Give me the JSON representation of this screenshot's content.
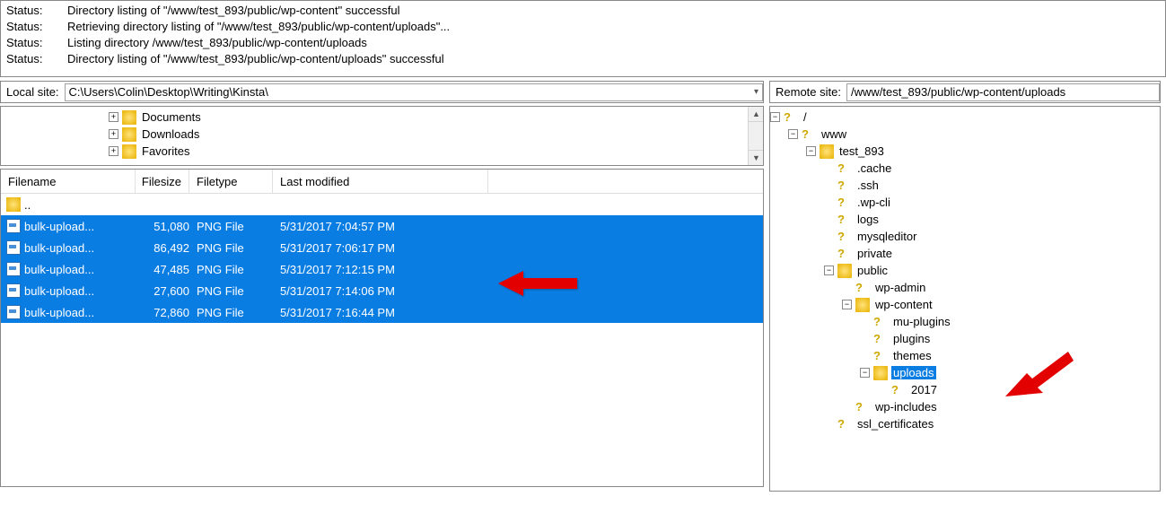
{
  "status": {
    "label": "Status:",
    "lines": [
      "Directory listing of \"/www/test_893/public/wp-content\" successful",
      "Retrieving directory listing of \"/www/test_893/public/wp-content/uploads\"...",
      "Listing directory /www/test_893/public/wp-content/uploads",
      "Directory listing of \"/www/test_893/public/wp-content/uploads\" successful"
    ]
  },
  "local": {
    "label": "Local site:",
    "path": "C:\\Users\\Colin\\Desktop\\Writing\\Kinsta\\",
    "tree": [
      {
        "name": "Documents",
        "expander": "+"
      },
      {
        "name": "Downloads",
        "expander": "+"
      },
      {
        "name": "Favorites",
        "expander": "+"
      }
    ],
    "columns": {
      "filename": "Filename",
      "filesize": "Filesize",
      "filetype": "Filetype",
      "modified": "Last modified"
    },
    "parent_row": "..",
    "files": [
      {
        "name": "bulk-upload...",
        "size": "51,080",
        "type": "PNG File",
        "modified": "5/31/2017 7:04:57 PM"
      },
      {
        "name": "bulk-upload...",
        "size": "86,492",
        "type": "PNG File",
        "modified": "5/31/2017 7:06:17 PM"
      },
      {
        "name": "bulk-upload...",
        "size": "47,485",
        "type": "PNG File",
        "modified": "5/31/2017 7:12:15 PM"
      },
      {
        "name": "bulk-upload...",
        "size": "27,600",
        "type": "PNG File",
        "modified": "5/31/2017 7:14:06 PM"
      },
      {
        "name": "bulk-upload...",
        "size": "72,860",
        "type": "PNG File",
        "modified": "5/31/2017 7:16:44 PM"
      }
    ]
  },
  "remote": {
    "label": "Remote site:",
    "path": "/www/test_893/public/wp-content/uploads",
    "tree": [
      {
        "depth": 0,
        "exp": "-",
        "icon": "q",
        "name": "/",
        "sel": false
      },
      {
        "depth": 1,
        "exp": "-",
        "icon": "q",
        "name": "www",
        "sel": false
      },
      {
        "depth": 2,
        "exp": "-",
        "icon": "f",
        "name": "test_893",
        "sel": false
      },
      {
        "depth": 3,
        "exp": "",
        "icon": "q",
        "name": ".cache",
        "sel": false
      },
      {
        "depth": 3,
        "exp": "",
        "icon": "q",
        "name": ".ssh",
        "sel": false
      },
      {
        "depth": 3,
        "exp": "",
        "icon": "q",
        "name": ".wp-cli",
        "sel": false
      },
      {
        "depth": 3,
        "exp": "",
        "icon": "q",
        "name": "logs",
        "sel": false
      },
      {
        "depth": 3,
        "exp": "",
        "icon": "q",
        "name": "mysqleditor",
        "sel": false
      },
      {
        "depth": 3,
        "exp": "",
        "icon": "q",
        "name": "private",
        "sel": false
      },
      {
        "depth": 3,
        "exp": "-",
        "icon": "f",
        "name": "public",
        "sel": false
      },
      {
        "depth": 4,
        "exp": "",
        "icon": "q",
        "name": "wp-admin",
        "sel": false
      },
      {
        "depth": 4,
        "exp": "-",
        "icon": "f",
        "name": "wp-content",
        "sel": false
      },
      {
        "depth": 5,
        "exp": "",
        "icon": "q",
        "name": "mu-plugins",
        "sel": false
      },
      {
        "depth": 5,
        "exp": "",
        "icon": "q",
        "name": "plugins",
        "sel": false
      },
      {
        "depth": 5,
        "exp": "",
        "icon": "q",
        "name": "themes",
        "sel": false
      },
      {
        "depth": 5,
        "exp": "-",
        "icon": "f",
        "name": "uploads",
        "sel": true
      },
      {
        "depth": 6,
        "exp": "",
        "icon": "q",
        "name": "2017",
        "sel": false
      },
      {
        "depth": 4,
        "exp": "",
        "icon": "q",
        "name": "wp-includes",
        "sel": false
      },
      {
        "depth": 3,
        "exp": "",
        "icon": "q",
        "name": "ssl_certificates",
        "sel": false
      }
    ]
  }
}
